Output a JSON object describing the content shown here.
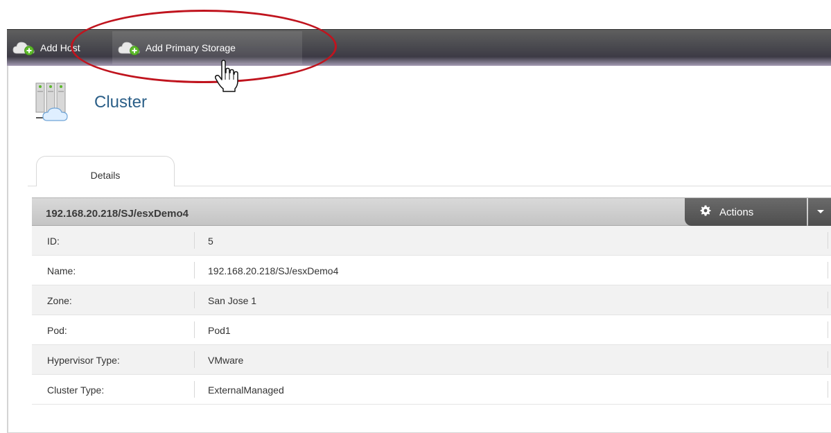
{
  "toolbar": {
    "add_host_label": "Add Host",
    "add_primary_storage_label": "Add Primary Storage"
  },
  "page": {
    "title": "Cluster"
  },
  "tabs": [
    {
      "label": "Details",
      "active": true
    }
  ],
  "details": {
    "header_title": "192.168.20.218/SJ/esxDemo4",
    "actions_label": "Actions",
    "rows": [
      {
        "label": "ID:",
        "value": "5"
      },
      {
        "label": "Name:",
        "value": "192.168.20.218/SJ/esxDemo4"
      },
      {
        "label": "Zone:",
        "value": "San Jose 1"
      },
      {
        "label": "Pod:",
        "value": "Pod1"
      },
      {
        "label": "Hypervisor Type:",
        "value": "VMware"
      },
      {
        "label": "Cluster Type:",
        "value": "ExternalManaged"
      }
    ]
  },
  "colors": {
    "title_blue": "#2b5f88",
    "highlight_red": "#c0141e",
    "toolbar_dark": "#3d3b45",
    "cloud_green": "#5cb82a"
  },
  "icons": {
    "add_host": "cloud-plus-icon",
    "add_primary_storage": "cloud-plus-icon",
    "cluster": "server-rack-cloud-icon",
    "actions": "gear-icon",
    "dropdown": "caret-down-icon",
    "cursor": "hand-pointer-icon"
  }
}
